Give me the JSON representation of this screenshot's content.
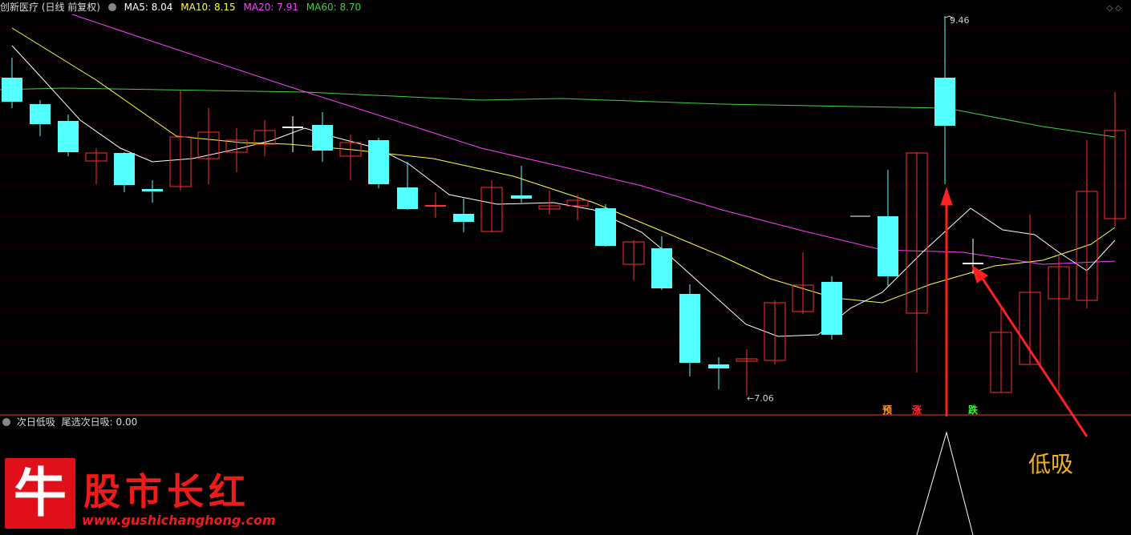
{
  "header": {
    "stock": "创新医疗 (日线 前复权)",
    "ma5": "MA5: 8.04",
    "ma10": "MA10: 8.15",
    "ma20": "MA20: 7.91",
    "ma60": "MA60: 8.70",
    "right_icons": "◇ ◇"
  },
  "colors": {
    "up": "#ff3030",
    "down": "#54ffff",
    "ma5": "#ffffff",
    "ma10": "#ffff40",
    "ma20": "#ff40ff",
    "ma60": "#40d040",
    "separator": "#ff3030"
  },
  "price_annotations": {
    "high": "9.46",
    "low": "←7.06"
  },
  "signal_labels": [
    {
      "text": "预",
      "color": "#ff9933"
    },
    {
      "text": "涨",
      "color": "#ff3030"
    },
    {
      "text": "跌",
      "color": "#30ff30"
    }
  ],
  "sub_header": {
    "name": "次日低吸",
    "indicator": "尾选次日吸: 0.00"
  },
  "annotation": "低吸",
  "logo": {
    "char": "牛",
    "title": "股市长红",
    "url": "www.gushichanghong.com"
  }
}
